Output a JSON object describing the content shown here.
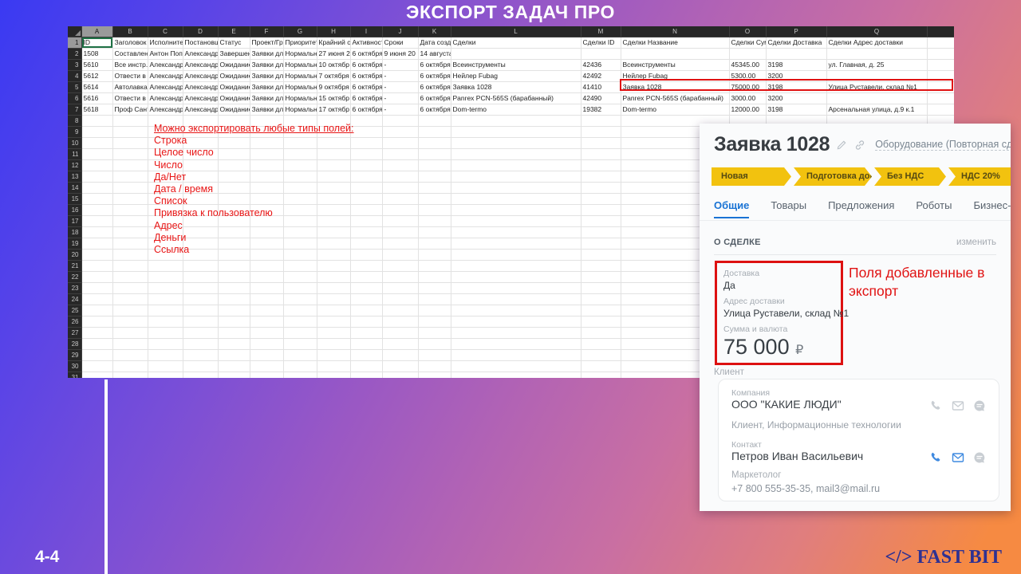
{
  "slide": {
    "title": "ЭКСПОРТ ЗАДАЧ ПРО",
    "page": "4-4",
    "brand_code": "</>",
    "brand_name": "FAST BIT"
  },
  "colors": {
    "accent_red": "#e01212",
    "stage_yellow": "#f2c20f",
    "active_tab_blue": "#1973d4",
    "brand_navy": "#2e3192",
    "selection_green": "#1f7145",
    "excel_header_dark": "#272727",
    "icon_blue": "#3f8ae0",
    "icon_gray": "#c9ced3",
    "background_gradient": [
      "#3a3af2",
      "#8b55c8",
      "#c96fa2",
      "#f68a42"
    ]
  },
  "icons": {
    "chevron_down": "▾"
  },
  "spreadsheet": {
    "column_letters": [
      "A",
      "B",
      "C",
      "D",
      "E",
      "F",
      "G",
      "H",
      "I",
      "J",
      "K",
      "L",
      "M",
      "N",
      "O",
      "P",
      "Q"
    ],
    "total_rows": 32,
    "data_rows": [
      {
        "n": 1,
        "cells": {
          "A": "ID",
          "B": "Заголовок",
          "C": "Исполнитель",
          "D": "Постановщик",
          "E": "Статус",
          "F": "Проект/Гр",
          "G": "Приоритет",
          "H": "Крайний ср",
          "I": "Активность",
          "J": "Сроки",
          "K": "Дата созд.",
          "L": "Сделки",
          "M": "Сделки ID",
          "N": "Сделки Название",
          "O": "Сделки Сум",
          "P": "Сделки Доставка",
          "Q": "Сделки Адрес доставки"
        }
      },
      {
        "n": 2,
        "cells": {
          "A": "1508",
          "B": "Составлени",
          "C": "Антон Поп",
          "D": "Александр",
          "E": "Завершен",
          "F": "Заявки дл",
          "G": "Нормальн",
          "H": "27 июня 2",
          "I": "6 октября",
          "J": "9 июня 20",
          "K": "14 августа"
        }
      },
      {
        "n": 3,
        "cells": {
          "A": "5610",
          "B": "Все инстр.",
          "C": "Александр",
          "D": "Александр",
          "E": "Ожидание",
          "F": "Заявки дл",
          "G": "Нормальн",
          "H": "10 октябр",
          "I": "6 октября",
          "J": "-",
          "K": "6 октября",
          "L": "Всеинструменты",
          "M": "42436",
          "N": "Всеинструменты",
          "O": "45345.00",
          "P": "3198",
          "Q": "ул. Главная, д. 25"
        }
      },
      {
        "n": 4,
        "cells": {
          "A": "5612",
          "B": "Отвести в",
          "C": "Александр",
          "D": "Александр",
          "E": "Ожидание",
          "F": "Заявки дл",
          "G": "Нормальн",
          "H": "7 октября",
          "I": "6 октября",
          "J": "-",
          "K": "6 октября",
          "L": "Нейлер Fubag",
          "M": "42492",
          "N": "Нейлер Fubag",
          "O": "5300.00",
          "P": "3200",
          "Q": ""
        }
      },
      {
        "n": 5,
        "cells": {
          "A": "5614",
          "B": "Автолавка",
          "C": "Александр",
          "D": "Александр",
          "E": "Ожидание",
          "F": "Заявки дл",
          "G": "Нормальн",
          "H": "9 октября",
          "I": "6 октября",
          "J": "-",
          "K": "6 октября",
          "L": "Заявка 1028",
          "M": "41410",
          "N": "Заявка 1028",
          "O": "75000.00",
          "P": "3198",
          "Q": "Улица Руставели, склад №1"
        }
      },
      {
        "n": 6,
        "cells": {
          "A": "5616",
          "B": "Отвести в",
          "C": "Александр",
          "D": "Александр",
          "E": "Ожидание",
          "F": "Заявки дл",
          "G": "Нормальн",
          "H": "15 октябр",
          "I": "6 октября",
          "J": "-",
          "K": "6 октября",
          "L": "Panrex PCN-565S (барабанный)",
          "M": "42490",
          "N": "Panrex PCN-565S (барабанный)",
          "O": "3000.00",
          "P": "3200",
          "Q": ""
        }
      },
      {
        "n": 7,
        "cells": {
          "A": "5618",
          "B": "Проф Сант",
          "C": "Александр",
          "D": "Александр",
          "E": "Ожидание",
          "F": "Заявки дл",
          "G": "Нормальн",
          "H": "17 октябр",
          "I": "6 октября",
          "J": "-",
          "K": "6 октября",
          "L": "Dom-termo",
          "M": "19382",
          "N": "Dom-termo",
          "O": "12000.00",
          "P": "3198",
          "Q": "Арсенальная улица, д.9 к.1"
        }
      }
    ],
    "annotation": {
      "title": "Можно экспортировать любые типы полей:",
      "items": [
        "Строка",
        "Целое число",
        "Число",
        "Да/Нет",
        "Дата / время",
        "Список",
        "Привязка к пользователю",
        "Адрес",
        "Деньги",
        "Ссылка"
      ]
    }
  },
  "crm": {
    "title": "Заявка 1028",
    "pipeline": "Оборудование (Повторная сделка)",
    "stages": [
      "Новая",
      "Подготовка доку...",
      "Без НДС",
      "НДС 20%"
    ],
    "tabs": [
      {
        "label": "Общие",
        "active": true
      },
      {
        "label": "Товары",
        "active": false
      },
      {
        "label": "Предложения",
        "active": false
      },
      {
        "label": "Роботы",
        "active": false
      },
      {
        "label": "Бизнес-процессы",
        "active": false
      }
    ],
    "about": {
      "title": "О СДЕЛКЕ",
      "action": "изменить"
    },
    "fields": [
      {
        "label": "Доставка",
        "value": "Да",
        "big": false
      },
      {
        "label": "Адрес доставки",
        "value": "Улица Руставели, склад №1",
        "big": false
      },
      {
        "label": "Сумма и валюта",
        "value": "75 000",
        "currency": "₽",
        "big": true
      }
    ],
    "annotation": "Поля добавленные в экспорт",
    "client_label": "Клиент",
    "company": {
      "label": "Компания",
      "name": "ООО \"КАКИЕ ЛЮДИ\"",
      "subtitle": "Клиент, Информационные технологии"
    },
    "contact": {
      "label": "Контакт",
      "name": "Петров Иван Васильевич",
      "role": "Маркетолог",
      "details": "+7 800 555-35-35, mail3@mail.ru"
    }
  }
}
